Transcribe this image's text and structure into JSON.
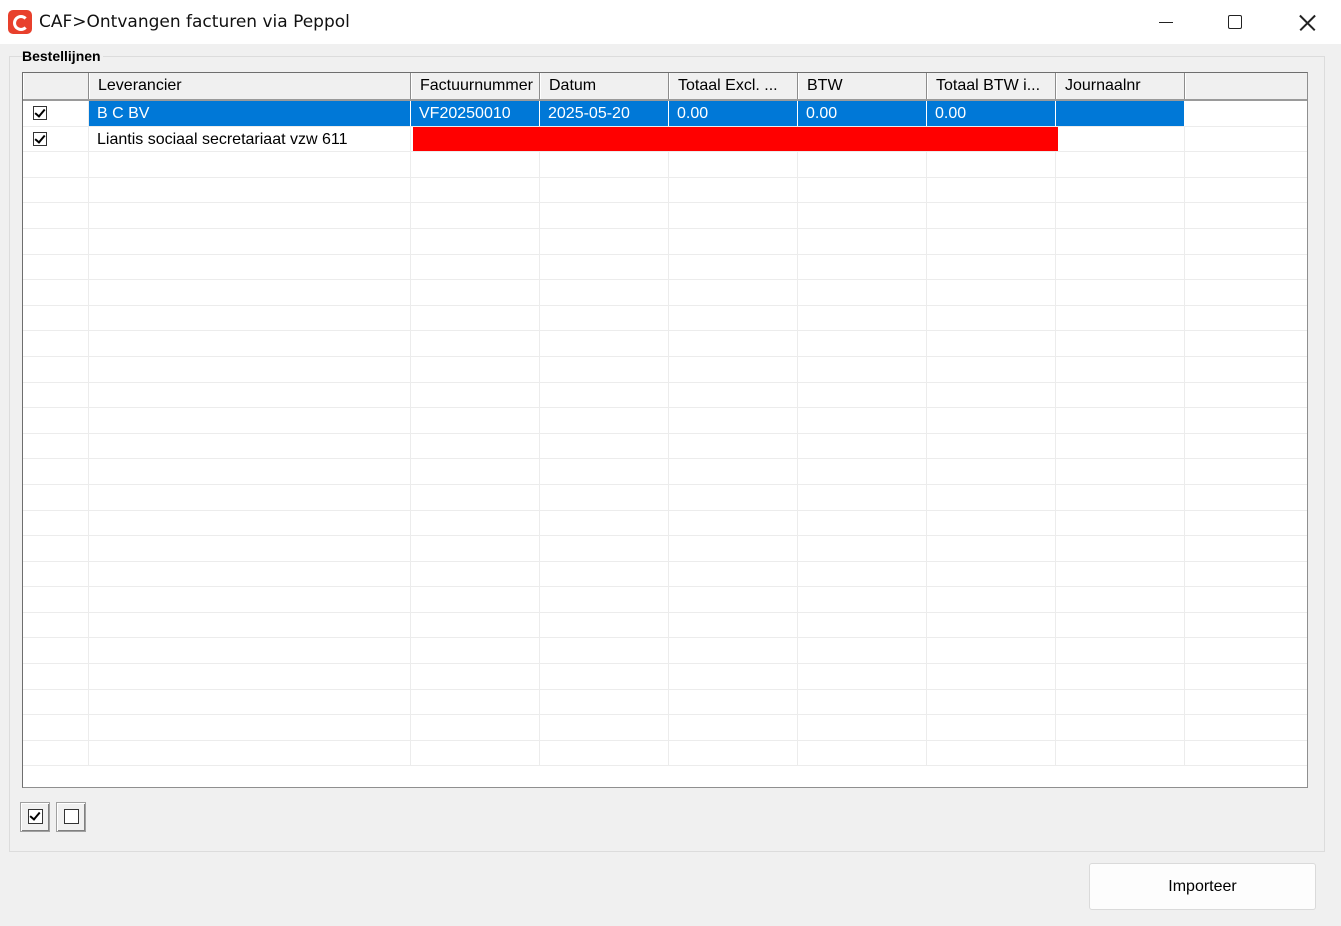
{
  "window": {
    "title": "CAF>Ontvangen facturen via Peppol"
  },
  "group": {
    "label": "Bestellijnen"
  },
  "grid": {
    "columns": [
      "",
      "Leverancier",
      "Factuurnummer",
      "Datum",
      "Totaal Excl. ...",
      "BTW",
      "Totaal BTW i...",
      "Journaalnr"
    ],
    "rows": [
      {
        "checked": true,
        "selected": true,
        "leverancier": "B C BV",
        "factuurnummer": "VF20250010",
        "datum": "2025-05-20",
        "totaal_excl": "0.00",
        "btw": "0.00",
        "totaal_btw_incl": "0.00",
        "journaalnr": ""
      },
      {
        "checked": true,
        "selected": false,
        "error_highlight": true,
        "leverancier": "Liantis sociaal secretariaat vzw 611",
        "factuurnummer": "",
        "datum": "",
        "totaal_excl": "",
        "btw": "",
        "totaal_btw_incl": "",
        "journaalnr": ""
      }
    ],
    "error_color": "#ff0000",
    "selection_color": "#0078d7"
  },
  "buttons": {
    "import_label": "Importeer"
  }
}
